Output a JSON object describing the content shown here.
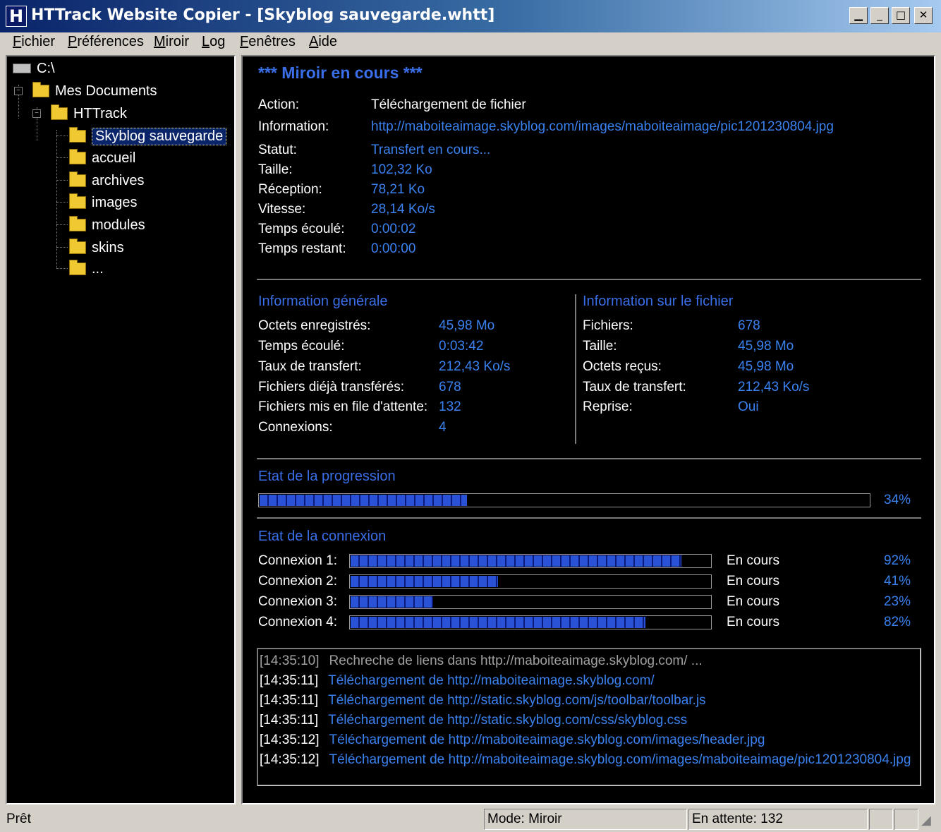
{
  "window": {
    "title": "HTTrack Website Copier - [Skyblog sauvegarde.whtt]",
    "app_icon_letter": "H",
    "minimize_glyph": "_",
    "restore_glyph": "□",
    "close_glyph": "✕",
    "inner_min_glyph": "▁"
  },
  "menu": [
    "Fichier",
    "Préférences",
    "Miroir",
    "Log",
    "Fenêtres",
    "Aide"
  ],
  "tree": {
    "drive": "C:\\",
    "mes_documents": "Mes Documents",
    "httrack": "HTTrack",
    "selected": "Skyblog sauvegarde",
    "children": [
      "accueil",
      "archives",
      "images",
      "modules",
      "skins",
      "..."
    ]
  },
  "mirror": {
    "heading": "*** Miroir en cours ***",
    "rows": [
      {
        "label": "Action:",
        "value": "Téléchargement de fichier"
      },
      {
        "label": "Information:",
        "value": "http://maboiteaimage.skyblog.com/images/maboiteaimage/pic1201230804.jpg"
      },
      {
        "label": "Statut:",
        "value": "Transfert en cours..."
      },
      {
        "label": "Taille:",
        "value": "102,32 Ko"
      },
      {
        "label": "Réception:",
        "value": "78,21 Ko"
      },
      {
        "label": "Vitesse:",
        "value": "28,14 Ko/s"
      },
      {
        "label": "Temps écoulé:",
        "value": "0:00:02"
      },
      {
        "label": "Temps restant:",
        "value": "0:00:00"
      }
    ]
  },
  "general": {
    "title": "Information générale",
    "rows": [
      {
        "label": "Octets enregistrés:",
        "value": "45,98 Mo"
      },
      {
        "label": "Temps écoulé:",
        "value": "0:03:42"
      },
      {
        "label": "Taux de transfert:",
        "value": "212,43 Ko/s"
      },
      {
        "label": "Fichiers diéjà transférés:",
        "value": "678"
      },
      {
        "label": "Fichiers mis en file d'attente:",
        "value": "132"
      },
      {
        "label": "Connexions:",
        "value": "4"
      }
    ]
  },
  "file_info": {
    "title": "Information sur le fichier",
    "rows": [
      {
        "label": "Fichiers:",
        "value": "678"
      },
      {
        "label": "Taille:",
        "value": "45,98 Mo"
      },
      {
        "label": "Octets reçus:",
        "value": "45,98 Mo"
      },
      {
        "label": "Taux de transfert:",
        "value": "212,43 Ko/s"
      },
      {
        "label": "Reprise:",
        "value": "Oui"
      }
    ]
  },
  "progress": {
    "title": "Etat de la progression",
    "percent_text": "34%",
    "fraction": 0.34
  },
  "connections": {
    "title": "Etat de la connexion",
    "items": [
      {
        "label": "Connexion 1:",
        "status": "En cours",
        "percent_text": "92%",
        "fraction": 0.92
      },
      {
        "label": "Connexion 2:",
        "status": "En cours",
        "percent_text": "41%",
        "fraction": 0.41
      },
      {
        "label": "Connexion 3:",
        "status": "En cours",
        "percent_text": "23%",
        "fraction": 0.23
      },
      {
        "label": "Connexion 4:",
        "status": "En cours",
        "percent_text": "82%",
        "fraction": 0.82
      }
    ]
  },
  "log": [
    {
      "time": "[14:35:10]",
      "msg": "Rechreche de liens dans http://maboiteaimage.skyblog.com/ ..."
    },
    {
      "time": "[14:35:11]",
      "msg": "Téléchargement de http://maboiteaimage.skyblog.com/"
    },
    {
      "time": "[14:35:11]",
      "msg": "Téléchargement de http://static.skyblog.com/js/toolbar/toolbar.js"
    },
    {
      "time": "[14:35:11]",
      "msg": "Téléchargement de http://static.skyblog.com/css/skyblog.css"
    },
    {
      "time": "[14:35:12]",
      "msg": "Téléchargement de http://maboiteaimage.skyblog.com/images/header.jpg"
    },
    {
      "time": "[14:35:12]",
      "msg": "Téléchargement de http://maboiteaimage.skyblog.com/images/maboiteaimage/pic1201230804.jpg"
    }
  ],
  "status": {
    "ready": "Prêt",
    "mode": "Mode: Miroir",
    "pending": "En attente: 132"
  },
  "colors": {
    "accent": "#3a82f0",
    "heading": "#3a6ee8",
    "titlebar": "#0a246a"
  }
}
